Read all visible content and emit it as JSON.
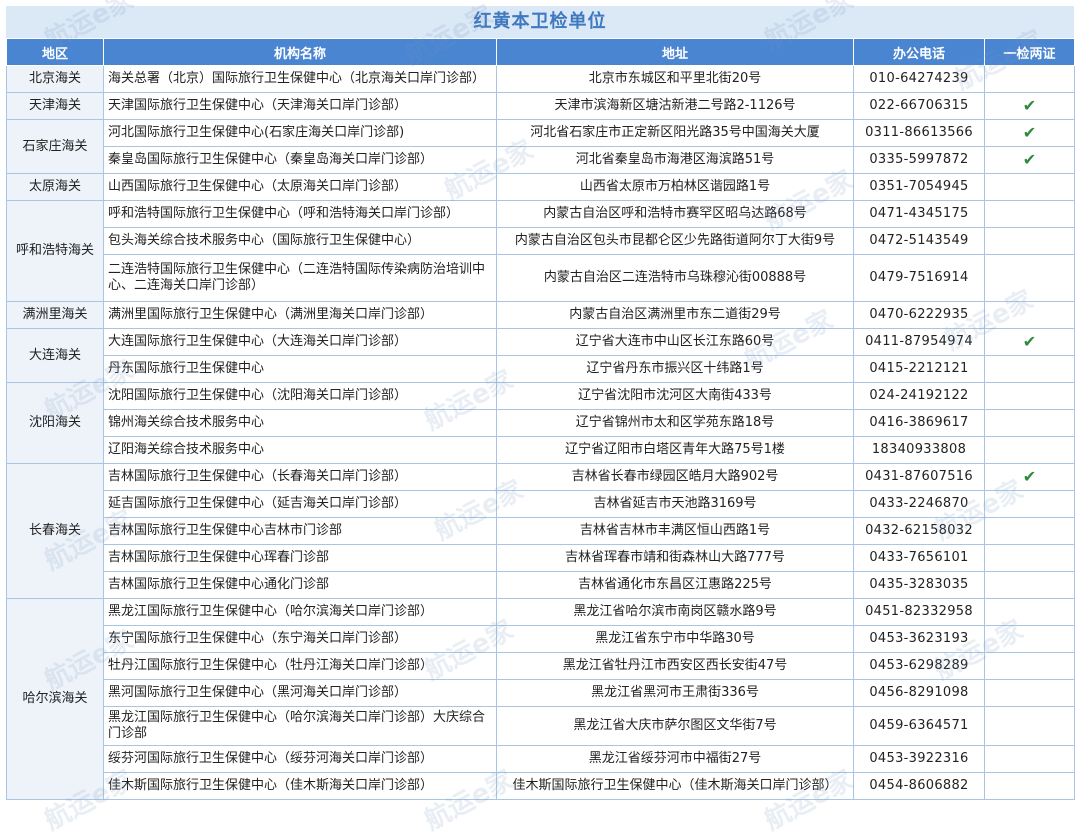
{
  "title": "红黄本卫检单位",
  "headers": {
    "region": "地区",
    "name": "机构名称",
    "address": "地址",
    "phone": "办公电话",
    "check": "一检两证"
  },
  "check_mark": "✔",
  "watermark": "航运e家",
  "groups": [
    {
      "region": "北京海关",
      "rows": [
        {
          "name": "海关总署（北京）国际旅行卫生保健中心（北京海关口岸门诊部）",
          "address": "北京市东城区和平里北街20号",
          "phone": "010-64274239",
          "check": false
        }
      ]
    },
    {
      "region": "天津海关",
      "rows": [
        {
          "name": "天津国际旅行卫生保健中心（天津海关口岸门诊部）",
          "address": "天津市滨海新区塘沽新港二号路2-1126号",
          "phone": "022-66706315",
          "check": true
        }
      ]
    },
    {
      "region": "石家庄海关",
      "rows": [
        {
          "name": "河北国际旅行卫生保健中心(石家庄海关口岸门诊部)",
          "address": "河北省石家庄市正定新区阳光路35号中国海关大厦",
          "phone": "0311-86613566",
          "check": true
        },
        {
          "name": "秦皇岛国际旅行卫生保健中心（秦皇岛海关口岸门诊部）",
          "address": "河北省秦皇岛市海港区海滨路51号",
          "phone": "0335-5997872",
          "check": true
        }
      ]
    },
    {
      "region": "太原海关",
      "rows": [
        {
          "name": "山西国际旅行卫生保健中心（太原海关口岸门诊部）",
          "address": "山西省太原市万柏林区谐园路1号",
          "phone": "0351-7054945",
          "check": false
        }
      ]
    },
    {
      "region": "呼和浩特海关",
      "rows": [
        {
          "name": "呼和浩特国际旅行卫生保健中心（呼和浩特海关口岸门诊部）",
          "address": "内蒙古自治区呼和浩特市赛罕区昭乌达路68号",
          "phone": "0471-4345175",
          "check": false
        },
        {
          "name": "包头海关综合技术服务中心（国际旅行卫生保健中心）",
          "address": "内蒙古自治区包头市昆都仑区少先路街道阿尔丁大街9号",
          "phone": "0472-5143549",
          "check": false
        },
        {
          "name": "二连浩特国际旅行卫生保健中心（二连浩特国际传染病防治培训中心、二连海关口岸门诊部）",
          "address": "内蒙古自治区二连浩特市乌珠穆沁街00888号",
          "phone": "0479-7516914",
          "check": false,
          "tall": 2
        }
      ]
    },
    {
      "region": "满洲里海关",
      "rows": [
        {
          "name": "满洲里国际旅行卫生保健中心（满洲里海关口岸门诊部）",
          "address": "内蒙古自治区满洲里市东二道街29号",
          "phone": "0470-6222935",
          "check": false
        }
      ]
    },
    {
      "region": "大连海关",
      "rows": [
        {
          "name": "大连国际旅行卫生保健中心（大连海关口岸门诊部）",
          "address": "辽宁省大连市中山区长江东路60号",
          "phone": "0411-87954974",
          "check": true
        },
        {
          "name": "丹东国际旅行卫生保健中心",
          "address": "辽宁省丹东市振兴区十纬路1号",
          "phone": "0415-2212121",
          "check": false
        }
      ]
    },
    {
      "region": "沈阳海关",
      "rows": [
        {
          "name": "沈阳国际旅行卫生保健中心（沈阳海关口岸门诊部）",
          "address": "辽宁省沈阳市沈河区大南街433号",
          "phone": "024-24192122",
          "check": false
        },
        {
          "name": "锦州海关综合技术服务中心",
          "address": "辽宁省锦州市太和区学苑东路18号",
          "phone": "0416-3869617",
          "check": false
        },
        {
          "name": "辽阳海关综合技术服务中心",
          "address": "辽宁省辽阳市白塔区青年大路75号1楼",
          "phone": "18340933808",
          "check": false
        }
      ]
    },
    {
      "region": "长春海关",
      "rows": [
        {
          "name": "吉林国际旅行卫生保健中心（长春海关口岸门诊部）",
          "address": "吉林省长春市绿园区皓月大路902号",
          "phone": "0431-87607516",
          "check": true
        },
        {
          "name": "延吉国际旅行卫生保健中心（延吉海关口岸门诊部）",
          "address": "吉林省延吉市天池路3169号",
          "phone": "0433-2246870",
          "check": false
        },
        {
          "name": "吉林国际旅行卫生保健中心吉林市门诊部",
          "address": "吉林省吉林市丰满区恒山西路1号",
          "phone": "0432-62158032",
          "check": false
        },
        {
          "name": "吉林国际旅行卫生保健中心珲春门诊部",
          "address": "吉林省珲春市靖和街森林山大路777号",
          "phone": "0433-7656101",
          "check": false
        },
        {
          "name": "吉林国际旅行卫生保健中心通化门诊部",
          "address": "吉林省通化市东昌区江惠路225号",
          "phone": "0435-3283035",
          "check": false
        }
      ]
    },
    {
      "region": "哈尔滨海关",
      "rows": [
        {
          "name": "黑龙江国际旅行卫生保健中心（哈尔滨海关口岸门诊部）",
          "address": "黑龙江省哈尔滨市南岗区赣水路9号",
          "phone": "0451-82332958",
          "check": false
        },
        {
          "name": "东宁国际旅行卫生保健中心（东宁海关口岸门诊部）",
          "address": "黑龙江省东宁市中华路30号",
          "phone": "0453-3623193",
          "check": false
        },
        {
          "name": "牡丹江国际旅行卫生保健中心（牡丹江海关口岸门诊部）",
          "address": "黑龙江省牡丹江市西安区西长安街47号",
          "phone": "0453-6298289",
          "check": false
        },
        {
          "name": "黑河国际旅行卫生保健中心（黑河海关口岸门诊部）",
          "address": "黑龙江省黑河市王肃街336号",
          "phone": "0456-8291098",
          "check": false
        },
        {
          "name": "黑龙江国际旅行卫生保健中心（哈尔滨海关口岸门诊部）大庆综合门诊部",
          "address": "黑龙江省大庆市萨尔图区文华街7号",
          "phone": "0459-6364571",
          "check": false,
          "tall": 1
        },
        {
          "name": "绥芬河国际旅行卫生保健中心（绥芬河海关口岸门诊部）",
          "address": "黑龙江省绥芬河市中福街27号",
          "phone": "0453-3922316",
          "check": false
        },
        {
          "name": "佳木斯国际旅行卫生保健中心（佳木斯海关口岸门诊部）",
          "address": "佳木斯国际旅行卫生保健中心（佳木斯海关口岸门诊部）",
          "phone": "0454-8606882",
          "check": false
        }
      ]
    }
  ]
}
